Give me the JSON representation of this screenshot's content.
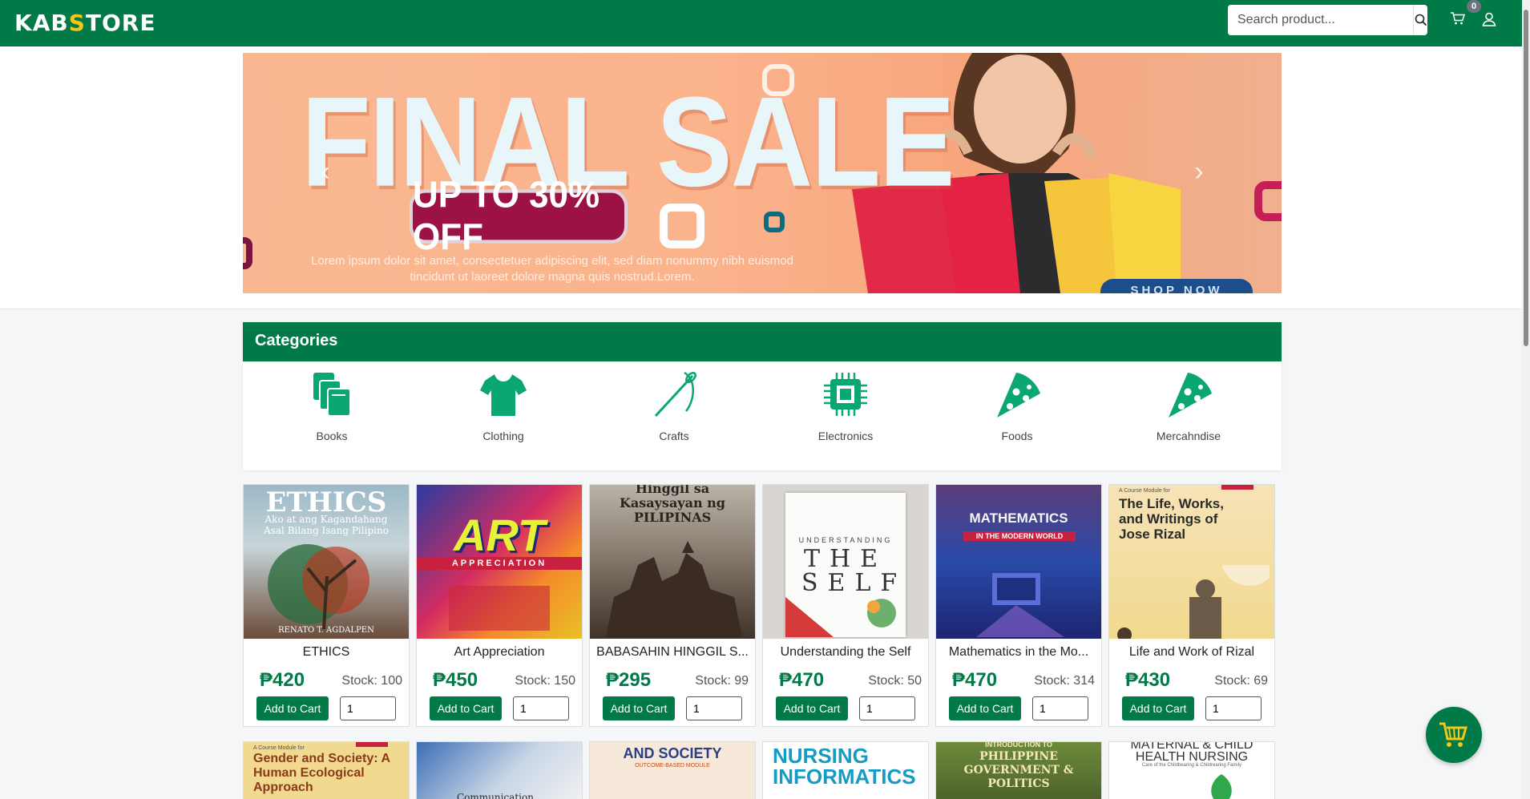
{
  "navbar": {
    "logo_left": "KAB",
    "logo_mid": "S",
    "logo_right": "TORE",
    "search_placeholder": "Search product...",
    "search_icon": "search-icon",
    "cart_icon": "cart-icon",
    "cart_count": "0",
    "user_icon": "user-icon",
    "brand_color": "#027a48"
  },
  "banner": {
    "title": "FINAL SALE",
    "subtitle": "UP TO 30% OFF",
    "body": "Lorem ipsum dolor sit amet, consectetuer adipiscing elit, sed diam nonummy nibh euismod tincidunt ut laoreet dolore magna quis nostrud.Lorem.",
    "cta": "SHOP NOW",
    "prev_icon": "chevron-left-icon",
    "next_icon": "chevron-right-icon"
  },
  "categories": {
    "title": "Categories",
    "items": [
      {
        "label": "Books",
        "icon": "books-icon"
      },
      {
        "label": "Clothing",
        "icon": "tshirt-icon"
      },
      {
        "label": "Crafts",
        "icon": "needle-icon"
      },
      {
        "label": "Electronics",
        "icon": "chip-icon"
      },
      {
        "label": "Foods",
        "icon": "pizza-icon"
      },
      {
        "label": "Mercahndise",
        "icon": "pizza-icon"
      }
    ]
  },
  "products": [
    {
      "name": "ETHICS",
      "price": "₱420",
      "stock": "Stock: 100",
      "qty": "1",
      "add_label": "Add to Cart",
      "cover_title": "ETHICS",
      "cover_sub": "Ako at ang Kagandahang Asal Bilang Isang Pilipino",
      "cover_author": "RENATO T. AGDALPEN"
    },
    {
      "name": "Art Appreciation",
      "price": "₱450",
      "stock": "Stock: 150",
      "qty": "1",
      "add_label": "Add to Cart",
      "cover_title": "ART",
      "cover_sub": "APPRECIATION"
    },
    {
      "name": "BABASAHIN HINGGIL S...",
      "price": "₱295",
      "stock": "Stock: 99",
      "qty": "1",
      "add_label": "Add to Cart",
      "cover_title": "Hinggil sa Kasaysayan ng PILIPINAS"
    },
    {
      "name": "Understanding the Self",
      "price": "₱470",
      "stock": "Stock: 50",
      "qty": "1",
      "add_label": "Add to Cart",
      "cover_title": "THE SELF",
      "cover_sub": "UNDERSTANDING"
    },
    {
      "name": "Mathematics in the Mo...",
      "price": "₱470",
      "stock": "Stock: 314",
      "qty": "1",
      "add_label": "Add to Cart",
      "cover_title": "MATHEMATICS",
      "cover_sub": "IN THE MODERN WORLD"
    },
    {
      "name": "Life and Work of Rizal",
      "price": "₱430",
      "stock": "Stock: 69",
      "qty": "1",
      "add_label": "Add to Cart",
      "cover_title": "The Life, Works, and Writings of Jose Rizal",
      "cover_sub": "A Course Module for"
    }
  ],
  "products_row2": [
    {
      "cover_title": "Gender and Society: A Human Ecological Approach",
      "cover_sub": "A Course Module for"
    },
    {
      "cover_title": "Communication"
    },
    {
      "cover_title": "AND SOCIETY",
      "cover_sub": "OUTCOME-BASED MODULE"
    },
    {
      "cover_title": "NURSING INFORMATICS"
    },
    {
      "cover_title": "PHILIPPINE GOVERNMENT & POLITICS",
      "cover_sub": "INTRODUCTION TO"
    },
    {
      "cover_title": "MATERNAL & CHILD HEALTH NURSING",
      "cover_sub": "Care of the Childbearing & Childrearing Family"
    }
  ],
  "floating_cart": {
    "icon": "cart-icon"
  }
}
